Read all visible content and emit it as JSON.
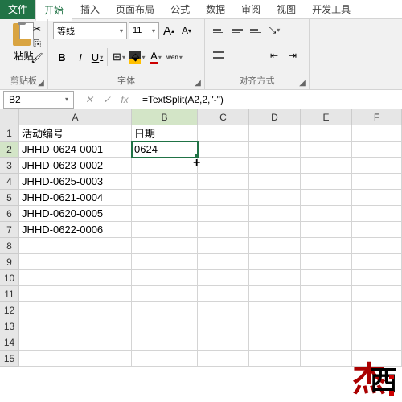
{
  "tabs": {
    "file": "文件",
    "home": "开始",
    "insert": "插入",
    "layout": "页面布局",
    "formula": "公式",
    "data": "数据",
    "review": "审阅",
    "view": "视图",
    "dev": "开发工具"
  },
  "ribbon": {
    "clipboard": {
      "paste": "粘贴",
      "label": "剪贴板"
    },
    "font": {
      "name": "等线",
      "size": "11",
      "label": "字体",
      "bold": "B",
      "italic": "I",
      "underline": "U",
      "bigA": "A",
      "smallA": "A"
    },
    "align": {
      "label": "对齐方式"
    }
  },
  "namebox": "B2",
  "formula": "=TextSplit(A2,2,\"-\")",
  "cols": [
    "A",
    "B",
    "C",
    "D",
    "E",
    "F"
  ],
  "grid": {
    "r1": {
      "A": "活动编号",
      "B": "日期"
    },
    "r2": {
      "A": "JHHD-0624-0001",
      "B": "0624"
    },
    "r3": {
      "A": "JHHD-0623-0002"
    },
    "r4": {
      "A": "JHHD-0625-0003"
    },
    "r5": {
      "A": "JHHD-0621-0004"
    },
    "r6": {
      "A": "JHHD-0620-0005"
    },
    "r7": {
      "A": "JHHD-0622-0006"
    }
  },
  "rownums": [
    "1",
    "2",
    "3",
    "4",
    "5",
    "6",
    "7",
    "8",
    "9",
    "10",
    "11",
    "12",
    "13",
    "14",
    "15"
  ],
  "watermark": {
    "c1": "杰",
    "c2": "西"
  }
}
